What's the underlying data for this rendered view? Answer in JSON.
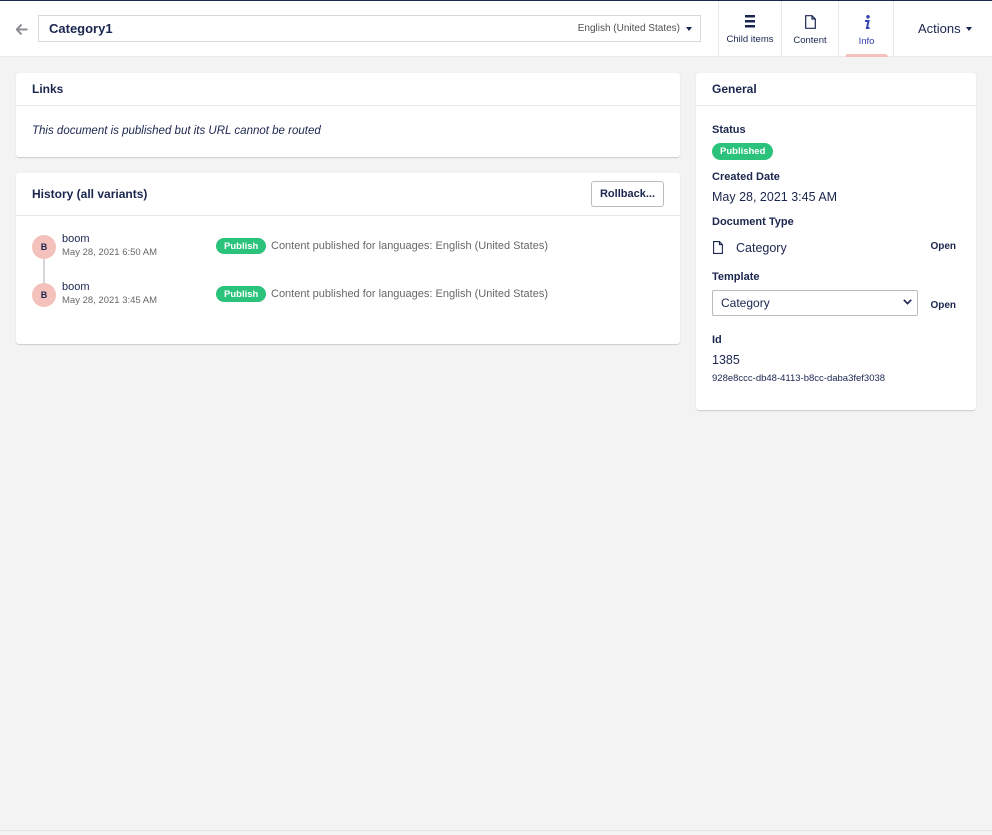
{
  "header": {
    "document_name": "Category1",
    "language": "English (United States)",
    "apps": [
      {
        "label": "Child items",
        "icon": "list-icon"
      },
      {
        "label": "Content",
        "icon": "document-icon"
      },
      {
        "label": "Info",
        "icon": "info-icon",
        "active": true
      }
    ],
    "actions_label": "Actions"
  },
  "links": {
    "title": "Links",
    "message": "This document is published but its URL cannot be routed"
  },
  "history": {
    "title": "History (all variants)",
    "rollback_label": "Rollback...",
    "items": [
      {
        "initial": "B",
        "user": "boom",
        "date": "May 28, 2021 6:50 AM",
        "badge": "Publish",
        "description": "Content published for languages: English (United States)"
      },
      {
        "initial": "B",
        "user": "boom",
        "date": "May 28, 2021 3:45 AM",
        "badge": "Publish",
        "description": "Content published for languages: English (United States)"
      }
    ]
  },
  "general": {
    "title": "General",
    "status_label": "Status",
    "status_value": "Published",
    "created_label": "Created Date",
    "created_value": "May 28, 2021 3:45 AM",
    "doctype_label": "Document Type",
    "doctype_value": "Category",
    "doctype_open": "Open",
    "template_label": "Template",
    "template_value": "Category",
    "template_open": "Open",
    "id_label": "Id",
    "id_value": "1385",
    "guid_value": "928e8ccc-db48-4113-b8cc-daba3fef3038"
  },
  "colors": {
    "brand_navy": "#1b264f",
    "published_green": "#2bc37c",
    "avatar_pink": "#f5c1bc",
    "active_blue": "#3544b1"
  }
}
